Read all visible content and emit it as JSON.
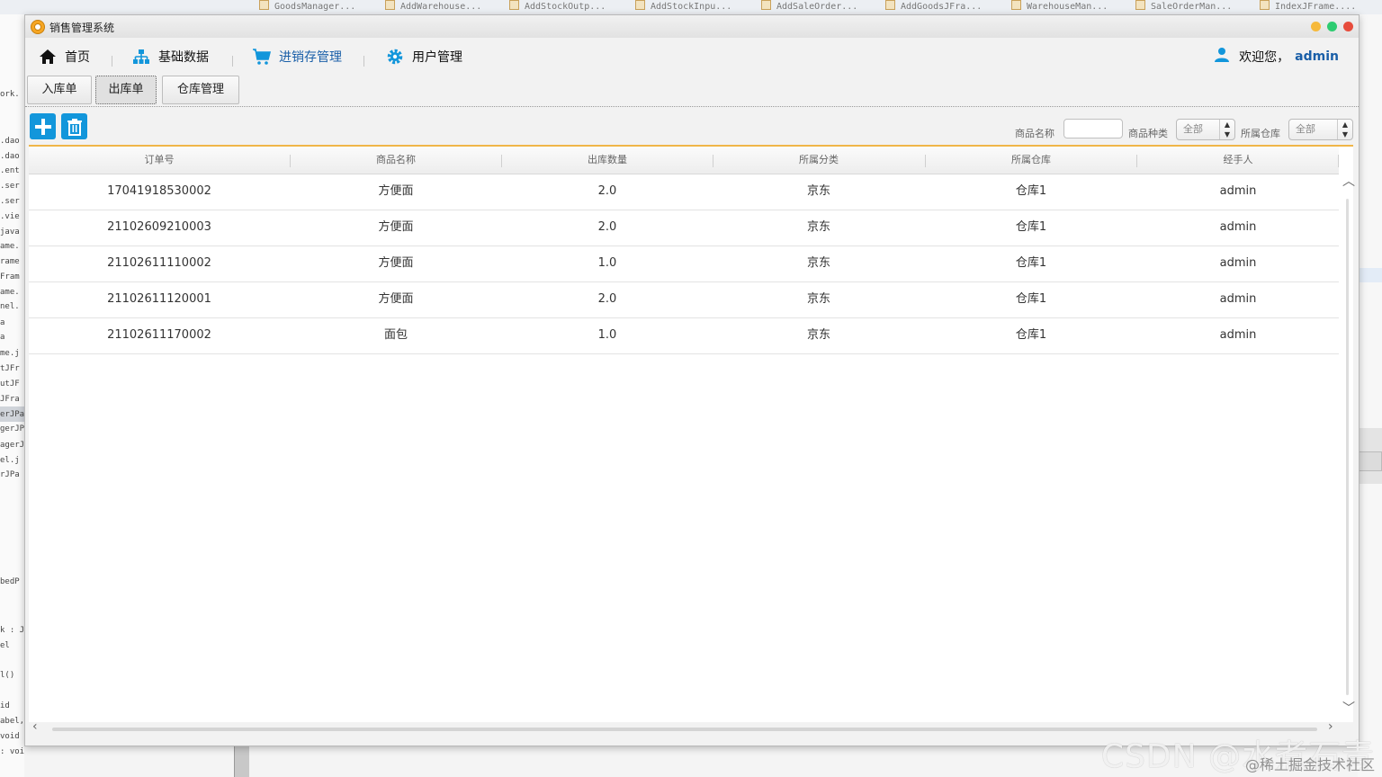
{
  "background": {
    "tabs": [
      "GoodsManager...",
      "AddWarehouse...",
      "AddStockOutp...",
      "AddStockInpu...",
      "AddSaleOrder...",
      "AddGoodsJFra...",
      "WarehouseMan...",
      "SaleOrderMan...",
      "IndexJFrame...."
    ],
    "left_code": [
      "ork.",
      ".dao",
      ".dao",
      ".ent",
      ".ser",
      ".ser",
      ".vie",
      "java",
      "ame.",
      "rame",
      "Fram",
      "ame.",
      "nel.",
      "a",
      "a",
      "me.j",
      "tJFr",
      "utJF",
      "JFra",
      "erJPa",
      "gerJP",
      "agerJ",
      "el.j",
      "rJPa",
      "bedP",
      "k : J",
      "el",
      "l()",
      "id",
      "abel,",
      "void",
      ": void"
    ],
    "watermark": "CSDN @水煮石青",
    "watermark_sub": "@稀土掘金技术社区"
  },
  "window": {
    "title": "销售管理系统",
    "traffic_lights": [
      "#f6b93b",
      "#2ecc71",
      "#e74c3c"
    ]
  },
  "menu": {
    "items": [
      {
        "label": "首页",
        "icon": "home-icon"
      },
      {
        "label": "基础数据",
        "icon": "sitemap-icon"
      },
      {
        "label": "进销存管理",
        "icon": "cart-icon",
        "active": true
      },
      {
        "label": "用户管理",
        "icon": "gear-icon"
      }
    ],
    "welcome": "欢迎您，",
    "username": "admin",
    "accent": "#1a5fa8",
    "icon_blue": "#1296db"
  },
  "tabs": [
    {
      "label": "入库单"
    },
    {
      "label": "出库单",
      "active": true
    },
    {
      "label": "仓库管理"
    }
  ],
  "toolbar": {
    "add_icon": "plus-icon",
    "delete_icon": "trash-icon",
    "filters": {
      "goods_name_label": "商品名称",
      "goods_name_value": "",
      "category_label": "商品种类",
      "category_value": "全部",
      "warehouse_label": "所属仓库",
      "warehouse_value": "全部"
    }
  },
  "table": {
    "columns": [
      "订单号",
      "商品名称",
      "出库数量",
      "所属分类",
      "所属仓库",
      "经手人"
    ],
    "rows": [
      [
        "17041918530002",
        "方便面",
        "2.0",
        "京东",
        "仓库1",
        "admin"
      ],
      [
        "21102609210003",
        "方便面",
        "2.0",
        "京东",
        "仓库1",
        "admin"
      ],
      [
        "21102611110002",
        "方便面",
        "1.0",
        "京东",
        "仓库1",
        "admin"
      ],
      [
        "21102611120001",
        "方便面",
        "2.0",
        "京东",
        "仓库1",
        "admin"
      ],
      [
        "21102611170002",
        "面包",
        "1.0",
        "京东",
        "仓库1",
        "admin"
      ]
    ]
  }
}
